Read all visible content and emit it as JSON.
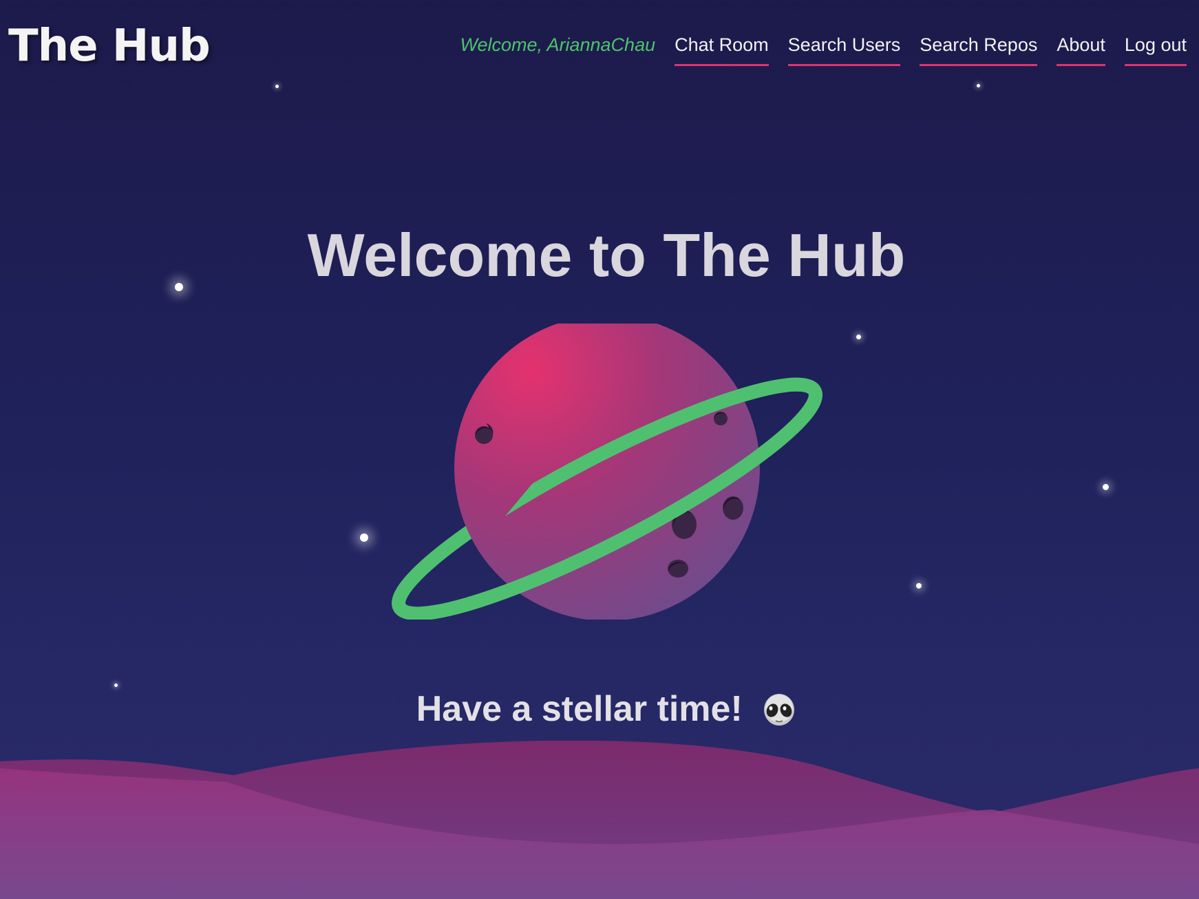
{
  "header": {
    "logo": "The Hub",
    "welcome_text": "Welcome, AriannaChau",
    "nav": [
      {
        "label": "Chat Room"
      },
      {
        "label": "Search Users"
      },
      {
        "label": "Search Repos"
      },
      {
        "label": "About"
      },
      {
        "label": "Log out"
      }
    ]
  },
  "hero": {
    "title": "Welcome to The Hub",
    "tagline": "Have a stellar time!",
    "tagline_icon": "alien-icon"
  },
  "illustration": {
    "planet_icon": "ringed-planet",
    "colors": {
      "planet_light": "#e4326e",
      "planet_dark": "#6d4c8c",
      "ring": "#4fc070",
      "hills_front": "#8d3a86",
      "hills_back": "#7a2868"
    }
  },
  "theme": {
    "background_top": "#1d1a4b",
    "background_bottom": "#2b2a68",
    "accent": "#e0336f",
    "welcome_color": "#4cc46a"
  }
}
